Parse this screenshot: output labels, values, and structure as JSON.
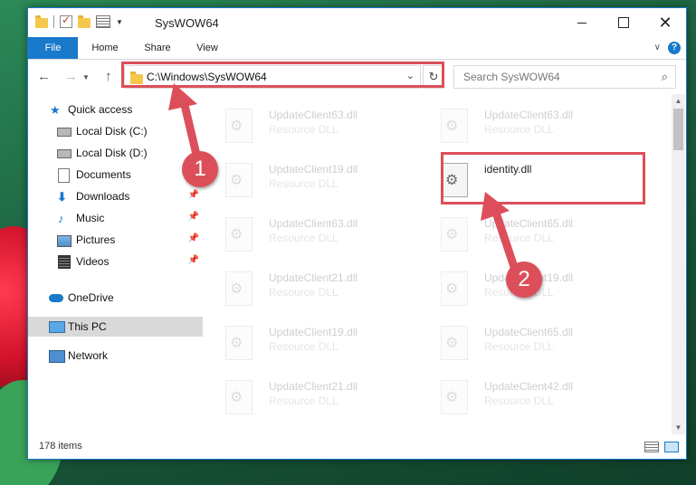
{
  "window": {
    "title": "SysWOW64",
    "minimize_glyph": "—",
    "close_glyph": "✕",
    "help_glyph": "?",
    "ribbon_collapse_glyph": "∨"
  },
  "ribbon": {
    "tabs": [
      {
        "label": "File"
      },
      {
        "label": "Home"
      },
      {
        "label": "Share"
      },
      {
        "label": "View"
      }
    ]
  },
  "navigation": {
    "back_glyph": "←",
    "forward_glyph": "→",
    "recent_glyph": "⌄",
    "up_glyph": "↑",
    "address": "C:\\Windows\\SysWOW64",
    "address_dropdown_glyph": "⌄",
    "refresh_glyph": "↻",
    "search_placeholder": "Search SysWOW64",
    "search_glyph": "⌕"
  },
  "sidebar": {
    "pin_glyph": "📌",
    "items": [
      {
        "label": "Quick access",
        "icon": "star-icon"
      },
      {
        "label": "Local Disk (C:)",
        "icon": "drive-icon"
      },
      {
        "label": "Local Disk (D:)",
        "icon": "drive-icon"
      },
      {
        "label": "Documents",
        "icon": "documents-icon"
      },
      {
        "label": "Downloads",
        "icon": "download-icon",
        "pinned": true
      },
      {
        "label": "Music",
        "icon": "music-icon",
        "pinned": true
      },
      {
        "label": "Pictures",
        "icon": "pictures-icon",
        "pinned": true
      },
      {
        "label": "Videos",
        "icon": "videos-icon",
        "pinned": true
      },
      {
        "label": "OneDrive",
        "icon": "onedrive-icon"
      },
      {
        "label": "This PC",
        "icon": "this-pc-icon",
        "selected": true
      },
      {
        "label": "Network",
        "icon": "network-icon"
      }
    ]
  },
  "files": [
    {
      "name": "UpdateClient63.dll",
      "type": "Resource DLL",
      "faded": true
    },
    {
      "name": "UpdateClient63.dll",
      "type": "Resource DLL",
      "faded": true
    },
    {
      "name": "UpdateClient19.dll",
      "type": "Resource DLL",
      "faded": true
    },
    {
      "name": "identity.dll",
      "type": "",
      "faded": false
    },
    {
      "name": "UpdateClient63.dll",
      "type": "Resource DLL",
      "faded": true
    },
    {
      "name": "UpdateClient65.dll",
      "type": "Resource DLL",
      "faded": true
    },
    {
      "name": "UpdateClient21.dll",
      "type": "Resource DLL",
      "faded": true
    },
    {
      "name": "UpdateClient19.dll",
      "type": "Resource DLL",
      "faded": true
    },
    {
      "name": "UpdateClient19.dll",
      "type": "Resource DLL",
      "faded": true
    },
    {
      "name": "UpdateClient65.dll",
      "type": "Resource DLL",
      "faded": true
    },
    {
      "name": "UpdateClient21.dll",
      "type": "Resource DLL",
      "faded": true
    },
    {
      "name": "UpdateClient42.dll",
      "type": "Resource DLL",
      "faded": true
    }
  ],
  "status": {
    "item_count": "178 items"
  },
  "annotations": {
    "step1": "1",
    "step2": "2",
    "color": "#dc4f5a"
  },
  "colors": {
    "accent": "#1979ca",
    "selection": "#d9d9d9"
  }
}
